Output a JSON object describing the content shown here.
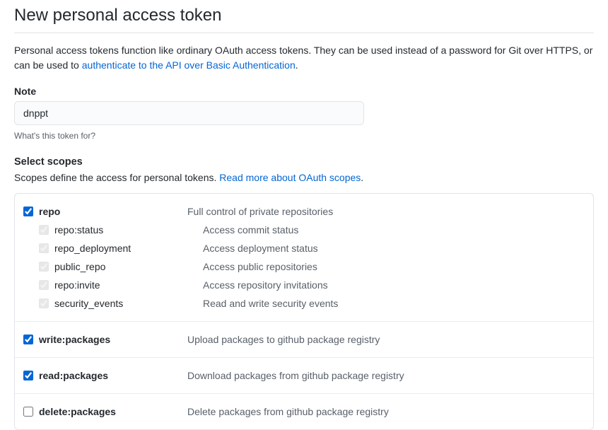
{
  "header": {
    "title": "New personal access token"
  },
  "intro": {
    "before": "Personal access tokens function like ordinary OAuth access tokens. They can be used instead of a password for Git over HTTPS, or can be used to ",
    "link": "authenticate to the API over Basic Authentication",
    "after": "."
  },
  "note": {
    "label": "Note",
    "value": "dnppt",
    "help": "What's this token for?"
  },
  "scopes": {
    "heading": "Select scopes",
    "desc_before": "Scopes define the access for personal tokens. ",
    "desc_link": "Read more about OAuth scopes",
    "desc_after": ".",
    "groups": [
      {
        "name": "repo",
        "desc": "Full control of private repositories",
        "checked": true,
        "children": [
          {
            "name": "repo:status",
            "desc": "Access commit status"
          },
          {
            "name": "repo_deployment",
            "desc": "Access deployment status"
          },
          {
            "name": "public_repo",
            "desc": "Access public repositories"
          },
          {
            "name": "repo:invite",
            "desc": "Access repository invitations"
          },
          {
            "name": "security_events",
            "desc": "Read and write security events"
          }
        ]
      },
      {
        "name": "write:packages",
        "desc": "Upload packages to github package registry",
        "checked": true
      },
      {
        "name": "read:packages",
        "desc": "Download packages from github package registry",
        "checked": true
      },
      {
        "name": "delete:packages",
        "desc": "Delete packages from github package registry",
        "checked": false
      }
    ]
  }
}
